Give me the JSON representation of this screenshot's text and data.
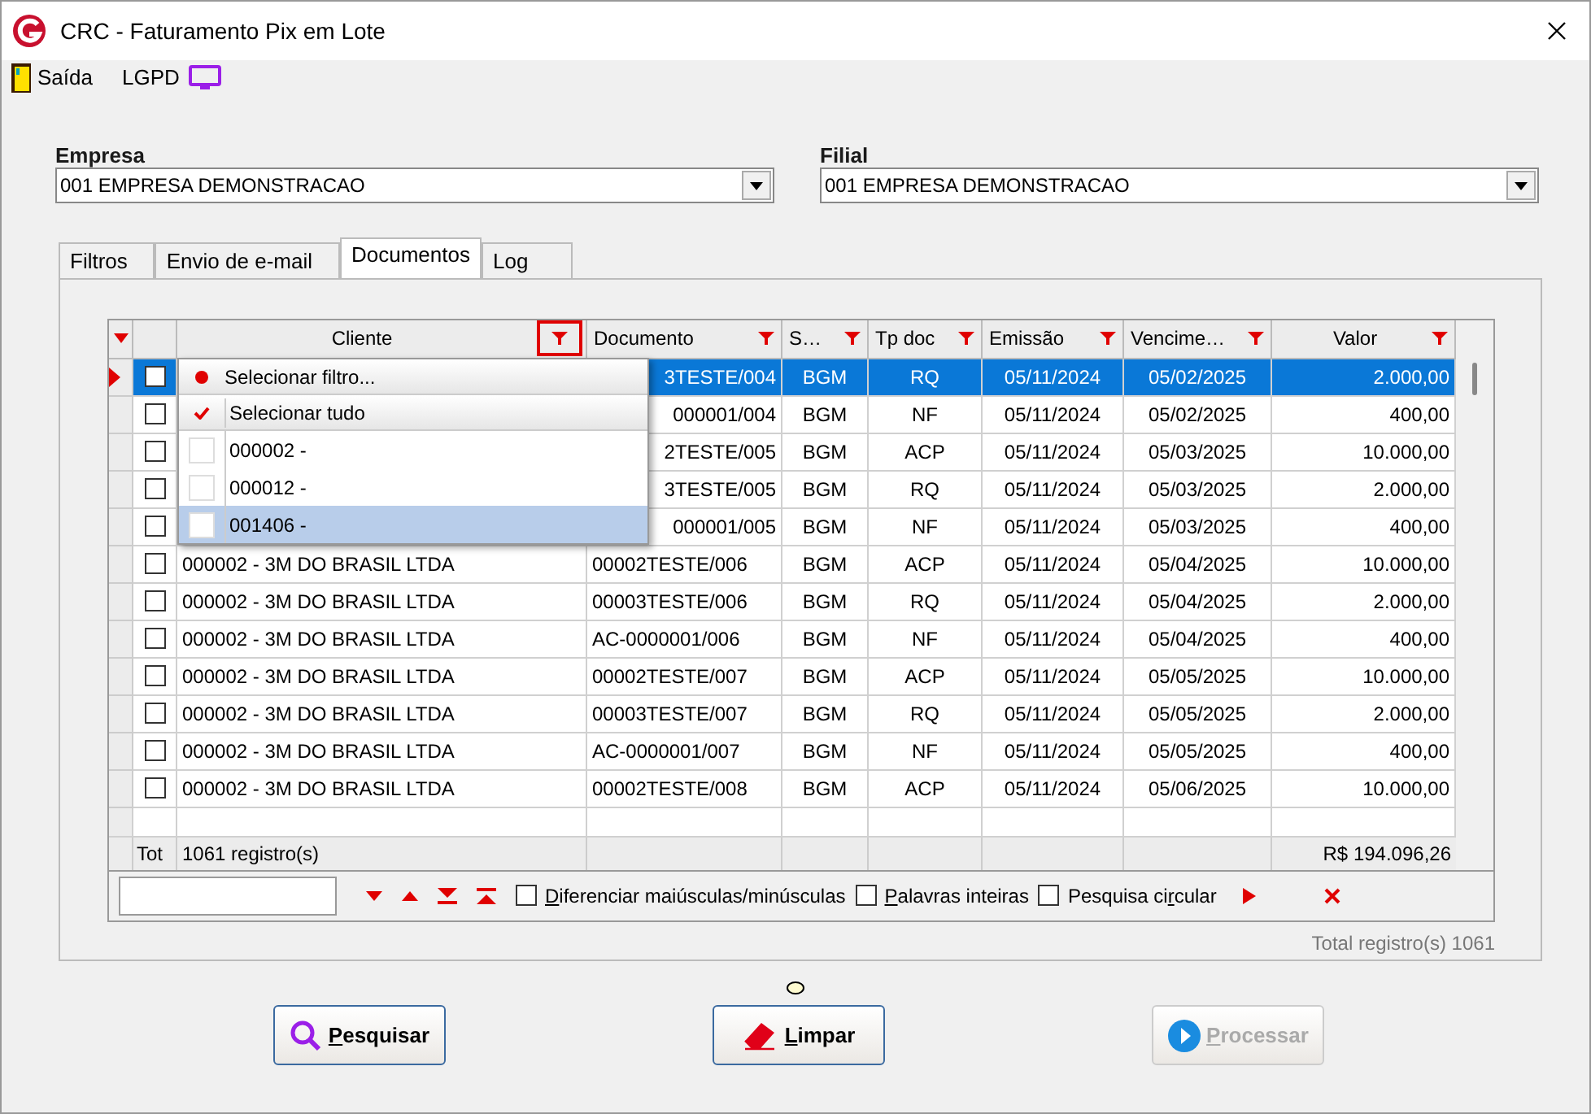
{
  "window": {
    "title": "CRC - Faturamento Pix em Lote"
  },
  "menu": [
    {
      "kind": "exit",
      "label": "Saída"
    },
    {
      "kind": "lgpd",
      "label": "LGPD"
    }
  ],
  "empresa": {
    "label": "Empresa",
    "value": "001 EMPRESA DEMONSTRACAO"
  },
  "filial": {
    "label": "Filial",
    "value": "001 EMPRESA DEMONSTRACAO"
  },
  "tabs": [
    {
      "label": "Filtros",
      "selected": false
    },
    {
      "label": "Envio de e-mail",
      "selected": false
    },
    {
      "label": "Documentos",
      "selected": true
    },
    {
      "label": "Log",
      "selected": false
    }
  ],
  "table": {
    "columns": [
      "Cliente",
      "Documento",
      "S…",
      "Tp doc",
      "Emissão",
      "Vencime…",
      "Valor"
    ],
    "rows": [
      {
        "documento": "3TESTE/004",
        "s": "BGM",
        "tp": "RQ",
        "emissao": "05/11/2024",
        "venc": "05/02/2025",
        "valor": "2.000,00",
        "selected": true,
        "checked": false
      },
      {
        "documento": "000001/004",
        "s": "BGM",
        "tp": "NF",
        "emissao": "05/11/2024",
        "venc": "05/02/2025",
        "valor": "400,00",
        "selected": false,
        "checked": false
      },
      {
        "documento": "2TESTE/005",
        "s": "BGM",
        "tp": "ACP",
        "emissao": "05/11/2024",
        "venc": "05/03/2025",
        "valor": "10.000,00",
        "selected": false,
        "checked": false
      },
      {
        "documento": "3TESTE/005",
        "s": "BGM",
        "tp": "RQ",
        "emissao": "05/11/2024",
        "venc": "05/03/2025",
        "valor": "2.000,00",
        "selected": false,
        "checked": false
      },
      {
        "documento": "000001/005",
        "s": "BGM",
        "tp": "NF",
        "emissao": "05/11/2024",
        "venc": "05/03/2025",
        "valor": "400,00",
        "selected": false,
        "checked": false
      },
      {
        "cliente": "000002 - 3M DO BRASIL LTDA",
        "documento": "00002TESTE/006",
        "s": "BGM",
        "tp": "ACP",
        "emissao": "05/11/2024",
        "venc": "05/04/2025",
        "valor": "10.000,00",
        "selected": false,
        "checked": false
      },
      {
        "cliente": "000002 - 3M DO BRASIL LTDA",
        "documento": "00003TESTE/006",
        "s": "BGM",
        "tp": "RQ",
        "emissao": "05/11/2024",
        "venc": "05/04/2025",
        "valor": "2.000,00",
        "selected": false,
        "checked": false
      },
      {
        "cliente": "000002 - 3M DO BRASIL LTDA",
        "documento": "AC-0000001/006",
        "s": "BGM",
        "tp": "NF",
        "emissao": "05/11/2024",
        "venc": "05/04/2025",
        "valor": "400,00",
        "selected": false,
        "checked": false
      },
      {
        "cliente": "000002 - 3M DO BRASIL LTDA",
        "documento": "00002TESTE/007",
        "s": "BGM",
        "tp": "ACP",
        "emissao": "05/11/2024",
        "venc": "05/05/2025",
        "valor": "10.000,00",
        "selected": false,
        "checked": false
      },
      {
        "cliente": "000002 - 3M DO BRASIL LTDA",
        "documento": "00003TESTE/007",
        "s": "BGM",
        "tp": "RQ",
        "emissao": "05/11/2024",
        "venc": "05/05/2025",
        "valor": "2.000,00",
        "selected": false,
        "checked": false
      },
      {
        "cliente": "000002 - 3M DO BRASIL LTDA",
        "documento": "AC-0000001/007",
        "s": "BGM",
        "tp": "NF",
        "emissao": "05/11/2024",
        "venc": "05/05/2025",
        "valor": "400,00",
        "selected": false,
        "checked": false
      },
      {
        "cliente": "000002 - 3M DO BRASIL LTDA",
        "documento": "00002TESTE/008",
        "s": "BGM",
        "tp": "ACP",
        "emissao": "05/11/2024",
        "venc": "05/06/2025",
        "valor": "10.000,00",
        "selected": false,
        "checked": false
      }
    ],
    "total": {
      "label": "Tot",
      "count": "1061 registro(s)",
      "sum": "R$ 194.096,26"
    }
  },
  "filter_popup": {
    "items": [
      {
        "kind": "action",
        "label": "Selecionar filtro...",
        "selected": false
      },
      {
        "kind": "check_all",
        "label": "Selecionar tudo",
        "selected": false
      },
      {
        "kind": "value",
        "label": "000002 -",
        "checked": false,
        "selected": false
      },
      {
        "kind": "value",
        "label": "000012 -",
        "checked": false,
        "selected": false
      },
      {
        "kind": "value",
        "label": "001406 -",
        "checked": false,
        "selected": true
      }
    ]
  },
  "search_bar": {
    "options": [
      {
        "accel": "D",
        "rest": "iferenciar maiúsculas/minúsculas",
        "checked": false
      },
      {
        "accel": "P",
        "rest": "alavras inteiras",
        "checked": false
      },
      {
        "pre": "Pesquisa ci",
        "accel": "r",
        "rest": "cular",
        "checked": false
      }
    ]
  },
  "status": "Total registro(s) 1061",
  "buttons": [
    {
      "kind": "search",
      "accel": "P",
      "rest": "esquisar",
      "disabled": false
    },
    {
      "kind": "clear",
      "accel": "L",
      "rest": "impar",
      "disabled": false
    },
    {
      "kind": "process",
      "accel": "P",
      "rest": "rocessar",
      "disabled": true
    }
  ]
}
